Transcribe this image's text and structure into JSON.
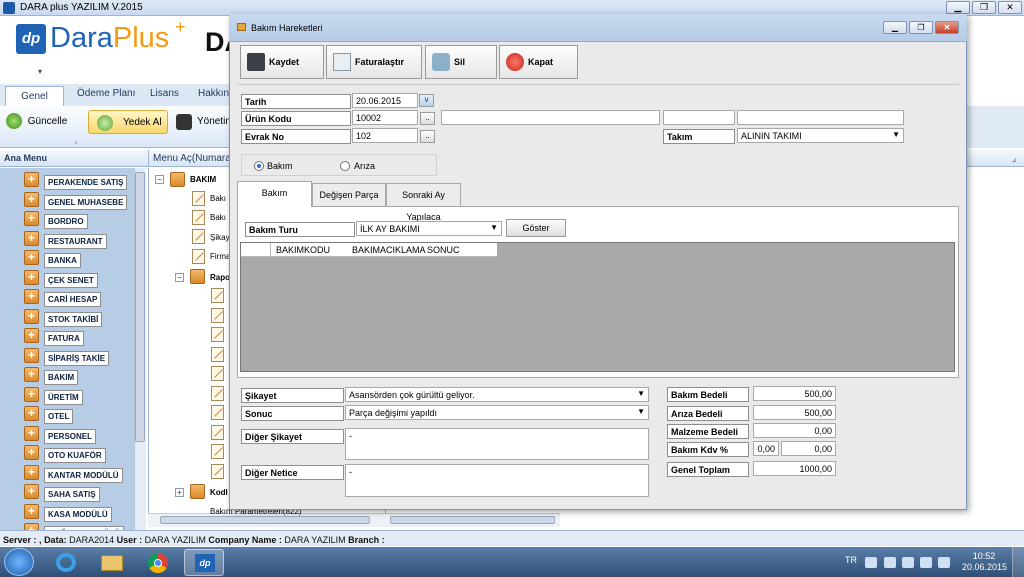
{
  "app": {
    "title": "DARA plus YAZILIM  V.2015"
  },
  "logo": {
    "dp": "dp",
    "text_a": "Dara",
    "text_b": "Plus",
    "sup": "+",
    "big": "DA"
  },
  "ribbon": {
    "tabs": [
      "Genel",
      "Ödeme Planı",
      "Lisans",
      "Hakkında"
    ],
    "buttons": [
      "Güncelle",
      "Yedek Al",
      "Yönetim"
    ]
  },
  "panes": {
    "ana_menu": "Ana Menu",
    "menu_ac": "Menu Aç(Numaraс"
  },
  "left_menu": [
    "PERAKENDE SATIŞ",
    "GENEL MUHASEBE",
    "BORDRO",
    "RESTAURANT",
    "BANKA",
    "ÇEK SENET",
    "CARİ HESAP",
    "STOK TAKİBİ",
    "FATURA",
    "SİPARİŞ TAKİE",
    "BAKIM",
    "ÜRETİM",
    "OTEL",
    "PERSONEL",
    "OTO KUAFÖR",
    "KANTAR MODÜLÜ",
    "SAHA SATIŞ",
    "KASA MODÜLÜ",
    "MAĞAZA MODÜLÜ"
  ],
  "tree": {
    "root": "BAKIM",
    "children": [
      "Bakı",
      "Bakı",
      "Şikay",
      "Firma"
    ],
    "raporlar": "Rapo",
    "kodlar": "Kodl",
    "last": "Bakım Parametreleri(822)"
  },
  "status": {
    "server_label": "Server :",
    "server": "",
    "data_label": "Data:",
    "data": "DARA2014",
    "user_label": "User :",
    "user": "DARA YAZILIM",
    "company_label": "Company Name :",
    "company": "DARA YAZILIM",
    "branch_label": "Branch :",
    "branch": ""
  },
  "taskbar": {
    "lang": "TR",
    "time": "10:52",
    "date": "20.06.2015"
  },
  "dialog": {
    "title": "Bakım Hareketleri",
    "toolbar": {
      "save": "Kaydet",
      "invoice": "Faturalaştır",
      "delete": "Sil",
      "close": "Kapat"
    },
    "labels": {
      "tarih": "Tarih",
      "urun_kodu": "Ürün Kodu",
      "evrak_no": "Evrak No",
      "takim": "Takım"
    },
    "values": {
      "tarih": "20.06.2015",
      "urun_kodu": "10002",
      "evrak_no": "102",
      "takim": "ALININ TAKIMI"
    },
    "radio": {
      "bakim": "Bakım",
      "ariza": "Arıza",
      "selected": "Bakım"
    },
    "tabs": [
      "Bakım",
      "Değişen Parça",
      "Sonraki Ay Yapılaca"
    ],
    "bakim_turu": {
      "label": "Bakım Turu",
      "value": "İLK AY BAKIMI",
      "button": "Göster"
    },
    "grid_columns": [
      "BAKIMKODU",
      "BAKIMACIKLAMA",
      "SONUC"
    ],
    "bottom": {
      "sikayet_label": "Şikayet",
      "sikayet": "Asansörden çok gürültü geliyor.",
      "sonuc_label": "Sonuc",
      "sonuc": "Parça değişimi yapıldı",
      "diger_sikayet_label": "Diğer Şikayet",
      "diger_sikayet": "-",
      "diger_netice_label": "Diğer Netice",
      "diger_netice": "-"
    },
    "totals": {
      "bakim_bedeli_label": "Bakım Bedeli",
      "bakim_bedeli": "500,00",
      "ariza_bedeli_label": "Arıza Bedeli",
      "ariza_bedeli": "500,00",
      "malzeme_bedeli_label": "Malzeme Bedeli",
      "malzeme_bedeli": "0,00",
      "kdv_label": "Bakım Kdv %",
      "kdv_rate": "0,00",
      "kdv_amount": "0,00",
      "genel_toplam_label": "Genel Toplam",
      "genel_toplam": "1000,00"
    }
  }
}
